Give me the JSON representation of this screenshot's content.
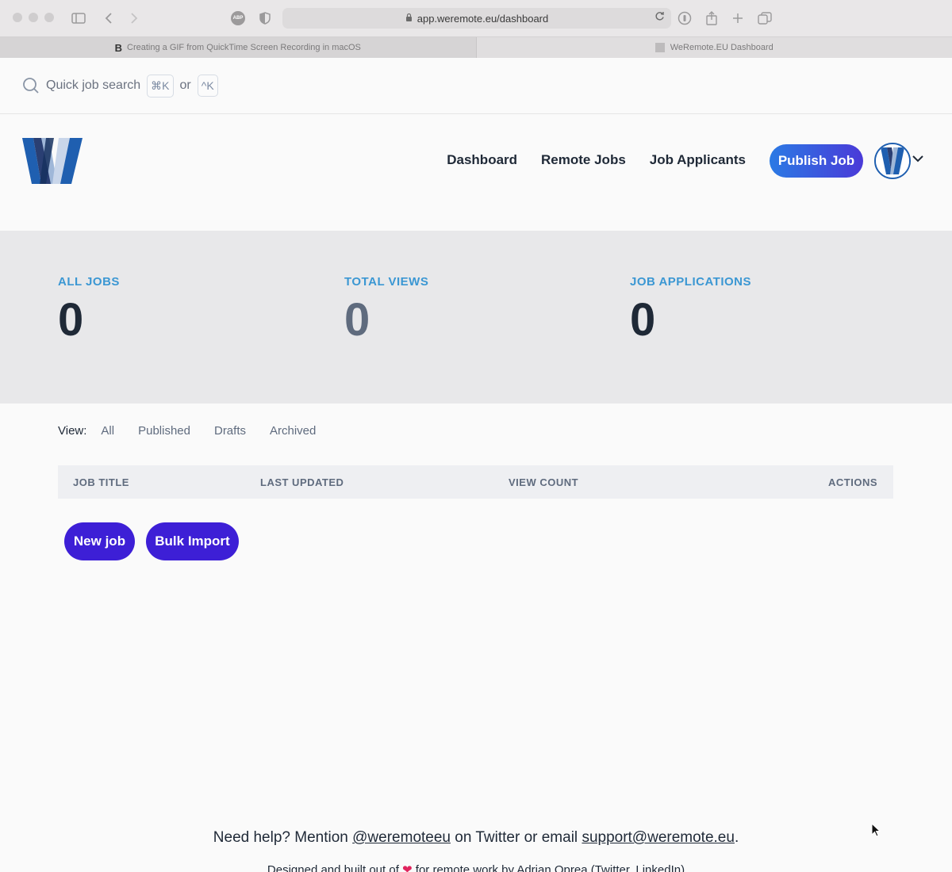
{
  "browser": {
    "url": "app.weremote.eu/dashboard",
    "tabs": [
      {
        "label": "Creating a GIF from QuickTime Screen Recording in macOS",
        "favicon": "B"
      },
      {
        "label": "WeRemote.EU Dashboard"
      }
    ],
    "abp_label": "ABP"
  },
  "search": {
    "label": "Quick job search",
    "shortcut_mac": "⌘K",
    "or_text": "or",
    "shortcut_other": "^K"
  },
  "nav": {
    "items": [
      "Dashboard",
      "Remote Jobs",
      "Job Applicants"
    ],
    "publish_label": "Publish Job"
  },
  "stats": [
    {
      "label": "ALL JOBS",
      "value": "0"
    },
    {
      "label": "TOTAL VIEWS",
      "value": "0"
    },
    {
      "label": "JOB APPLICATIONS",
      "value": "0"
    }
  ],
  "view_filter": {
    "label": "View:",
    "options": [
      "All",
      "Published",
      "Drafts",
      "Archived"
    ]
  },
  "table": {
    "columns": [
      "JOB TITLE",
      "LAST UPDATED",
      "VIEW COUNT",
      "ACTIONS"
    ]
  },
  "actions": {
    "new_job": "New job",
    "bulk_import": "Bulk Import"
  },
  "footer": {
    "help_prefix": "Need help? Mention",
    "twitter_handle": "@weremoteeu",
    "help_middle": "on Twitter or email",
    "email": "support@weremote.eu",
    "help_suffix": ".",
    "credit_prefix": "Designed and built out of",
    "credit_suffix": "for remote work by Adrian Oprea (Twitter, LinkedIn)"
  },
  "colors": {
    "accent_blue": "#3b97d3",
    "button_purple": "#3d1fd6",
    "publish_gradient_start": "#2b7ae4",
    "publish_gradient_end": "#4a3ad8"
  }
}
